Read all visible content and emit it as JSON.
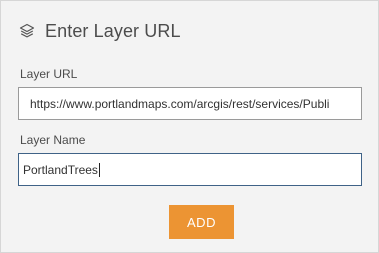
{
  "header": {
    "icon": "layers-icon",
    "title": "Enter Layer URL"
  },
  "layer_url": {
    "label": "Layer URL",
    "value": "https://www.portlandmaps.com/arcgis/rest/services/Publi"
  },
  "layer_name": {
    "label": "Layer Name",
    "value": "PortlandTrees"
  },
  "actions": {
    "add_label": "ADD"
  },
  "colors": {
    "panel_background": "#f3f3f3",
    "add_button": "#ec9433",
    "focused_border": "#3f6287"
  }
}
